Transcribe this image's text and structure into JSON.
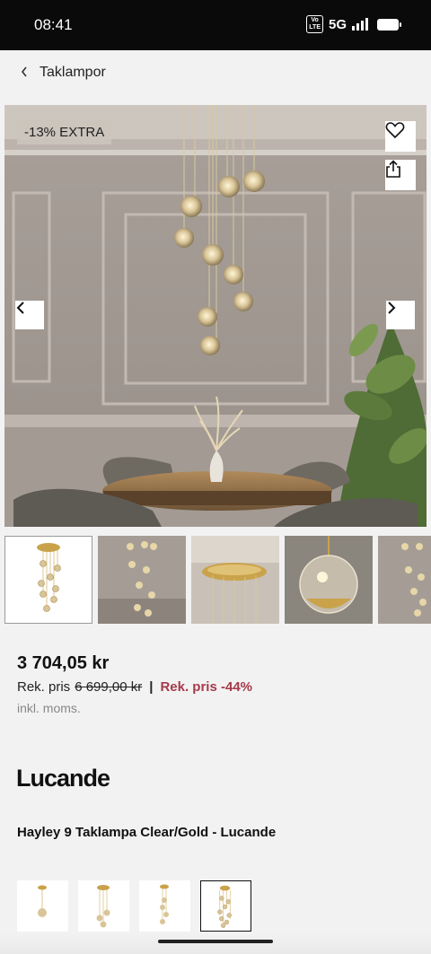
{
  "status_bar": {
    "time": "08:41",
    "volte": "Vo LTE",
    "network": "5G"
  },
  "breadcrumb": {
    "label": "Taklampor"
  },
  "hero": {
    "badge": "-13% EXTRA"
  },
  "price": {
    "current": "3 704,05 kr",
    "rek_label": "Rek. pris",
    "rek_old": "6 699,00 kr",
    "separator": "|",
    "discount": "Rek. pris -44%",
    "vat_note": "inkl. moms."
  },
  "brand": {
    "logo_text": "Lucande"
  },
  "product": {
    "title": "Hayley 9 Taklampa Clear/Gold - Lucande"
  },
  "colors": {
    "discount": "#a43a4a",
    "gold": "#c9a24a",
    "wall": "#a59d95"
  },
  "icons": {
    "favorite": "heart-icon",
    "share": "share-icon",
    "prev": "chevron-left-icon",
    "next": "chevron-right-icon",
    "back": "chevron-left-icon"
  }
}
